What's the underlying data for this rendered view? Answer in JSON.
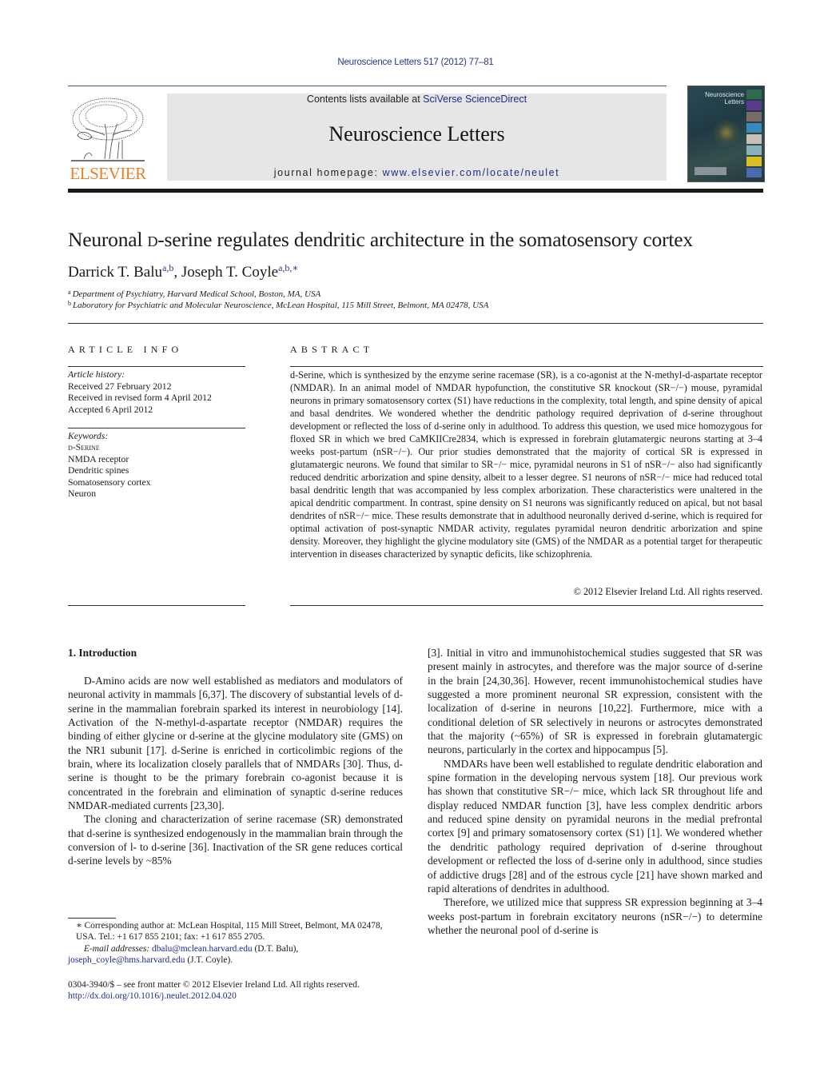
{
  "header": {
    "citation": "Neuroscience Letters 517 (2012) 77–81",
    "contents_prefix": "Contents lists available at ",
    "contents_link": "SciVerse ScienceDirect",
    "journal_title": "Neuroscience Letters",
    "homepage_prefix": "journal homepage: ",
    "homepage_link": "www.elsevier.com/locate/neulet",
    "publisher_logo_text": "ELSEVIER",
    "cover_title_line1": "Neuroscience",
    "cover_title_line2": "Letters",
    "colors": {
      "link": "#1f2a8c",
      "elsevier_orange": "#e7812d",
      "banner_bg": "#e6e6e6"
    }
  },
  "article": {
    "title_pre": "Neuronal ",
    "title_sc": "d",
    "title_post": "-serine regulates dendritic architecture in the somatosensory cortex",
    "authors": [
      {
        "name": "Darrick T. Balu",
        "affils": "a,b"
      },
      {
        "name": "Joseph T. Coyle",
        "affils": "a,b,∗"
      }
    ],
    "author_separator": ", ",
    "affiliations": [
      {
        "mark": "a",
        "text": "Department of Psychiatry, Harvard Medical School, Boston, MA, USA"
      },
      {
        "mark": "b",
        "text": "Laboratory for Psychiatric and Molecular Neuroscience, McLean Hospital, 115 Mill Street, Belmont, MA 02478, USA"
      }
    ]
  },
  "article_info": {
    "heading": "ARTICLE INFO",
    "history_label": "Article history:",
    "history": [
      "Received 27 February 2012",
      "Received in revised form 4 April 2012",
      "Accepted 6 April 2012"
    ],
    "keywords_label": "Keywords:",
    "keywords": [
      "d-Serine",
      "NMDA receptor",
      "Dendritic spines",
      "Somatosensory cortex",
      "Neuron"
    ]
  },
  "abstract": {
    "heading": "ABSTRACT",
    "text": "d-Serine, which is synthesized by the enzyme serine racemase (SR), is a co-agonist at the N-methyl-d-aspartate receptor (NMDAR). In an animal model of NMDAR hypofunction, the constitutive SR knockout (SR−/−) mouse, pyramidal neurons in primary somatosensory cortex (S1) have reductions in the complexity, total length, and spine density of apical and basal dendrites. We wondered whether the dendritic pathology required deprivation of d-serine throughout development or reflected the loss of d-serine only in adulthood. To address this question, we used mice homozygous for floxed SR in which we bred CaMKIICre2834, which is expressed in forebrain glutamatergic neurons starting at 3–4 weeks post-partum (nSR−/−). Our prior studies demonstrated that the majority of cortical SR is expressed in glutamatergic neurons. We found that similar to SR−/− mice, pyramidal neurons in S1 of nSR−/− also had significantly reduced dendritic arborization and spine density, albeit to a lesser degree. S1 neurons of nSR−/− mice had reduced total basal dendritic length that was accompanied by less complex arborization. These characteristics were unaltered in the apical dendritic compartment. In contrast, spine density on S1 neurons was significantly reduced on apical, but not basal dendrites of nSR−/− mice. These results demonstrate that in adulthood neuronally derived d-serine, which is required for optimal activation of post-synaptic NMDAR activity, regulates pyramidal neuron dendritic arborization and spine density. Moreover, they highlight the glycine modulatory site (GMS) of the NMDAR as a potential target for therapeutic intervention in diseases characterized by synaptic deficits, like schizophrenia.",
    "copyright": "© 2012 Elsevier Ireland Ltd. All rights reserved."
  },
  "body": {
    "section_heading": "1.  Introduction",
    "col1_paragraphs": [
      "D-Amino acids are now well established as mediators and modulators of neuronal activity in mammals [6,37]. The discovery of substantial levels of d-serine in the mammalian forebrain sparked its interest in neurobiology [14]. Activation of the N-methyl-d-aspartate receptor (NMDAR) requires the binding of either glycine or d-serine at the glycine modulatory site (GMS) on the NR1 subunit [17]. d-Serine is enriched in corticolimbic regions of the brain, where its localization closely parallels that of NMDARs [30]. Thus, d-serine is thought to be the primary forebrain co-agonist because it is concentrated in the forebrain and elimination of synaptic d-serine reduces NMDAR-mediated currents [23,30].",
      "The cloning and characterization of serine racemase (SR) demonstrated that d-serine is synthesized endogenously in the mammalian brain through the conversion of l- to d-serine [36]. Inactivation of the SR gene reduces cortical d-serine levels by ~85%"
    ],
    "col2_paragraphs": [
      "[3]. Initial in vitro and immunohistochemical studies suggested that SR was present mainly in astrocytes, and therefore was the major source of d-serine in the brain [24,30,36]. However, recent immunohistochemical studies have suggested a more prominent neuronal SR expression, consistent with the localization of d-serine in neurons [10,22]. Furthermore, mice with a conditional deletion of SR selectively in neurons or astrocytes demonstrated that the majority (~65%) of SR is expressed in forebrain glutamatergic neurons, particularly in the cortex and hippocampus [5].",
      "NMDARs have been well established to regulate dendritic elaboration and spine formation in the developing nervous system [18]. Our previous work has shown that constitutive SR−/− mice, which lack SR throughout life and display reduced NMDAR function [3], have less complex dendritic arbors and reduced spine density on pyramidal neurons in the medial prefrontal cortex [9] and primary somatosensory cortex (S1) [1]. We wondered whether the dendritic pathology required deprivation of d-serine throughout development or reflected the loss of d-serine only in adulthood, since studies of addictive drugs [28] and of the estrous cycle [21] have shown marked and rapid alterations of dendrites in adulthood.",
      "Therefore, we utilized mice that suppress SR expression beginning at 3–4 weeks post-partum in forebrain excitatory neurons (nSR−/−) to determine whether the neuronal pool of d-serine is"
    ]
  },
  "footnotes": {
    "corresponding": "∗ Corresponding author at: McLean Hospital, 115 Mill Street, Belmont, MA 02478, USA. Tel.: +1 617 855 2101; fax: +1 617 855 2705.",
    "email_label": "E-mail addresses: ",
    "email1": "dbalu@mclean.harvard.edu",
    "email1_owner": " (D.T. Balu),",
    "email2": "joseph_coyle@hms.harvard.edu",
    "email2_owner": " (J.T. Coyle).",
    "front_matter": "0304-3940/$ – see front matter © 2012 Elsevier Ireland Ltd. All rights reserved.",
    "doi": "http://dx.doi.org/10.1016/j.neulet.2012.04.020"
  }
}
